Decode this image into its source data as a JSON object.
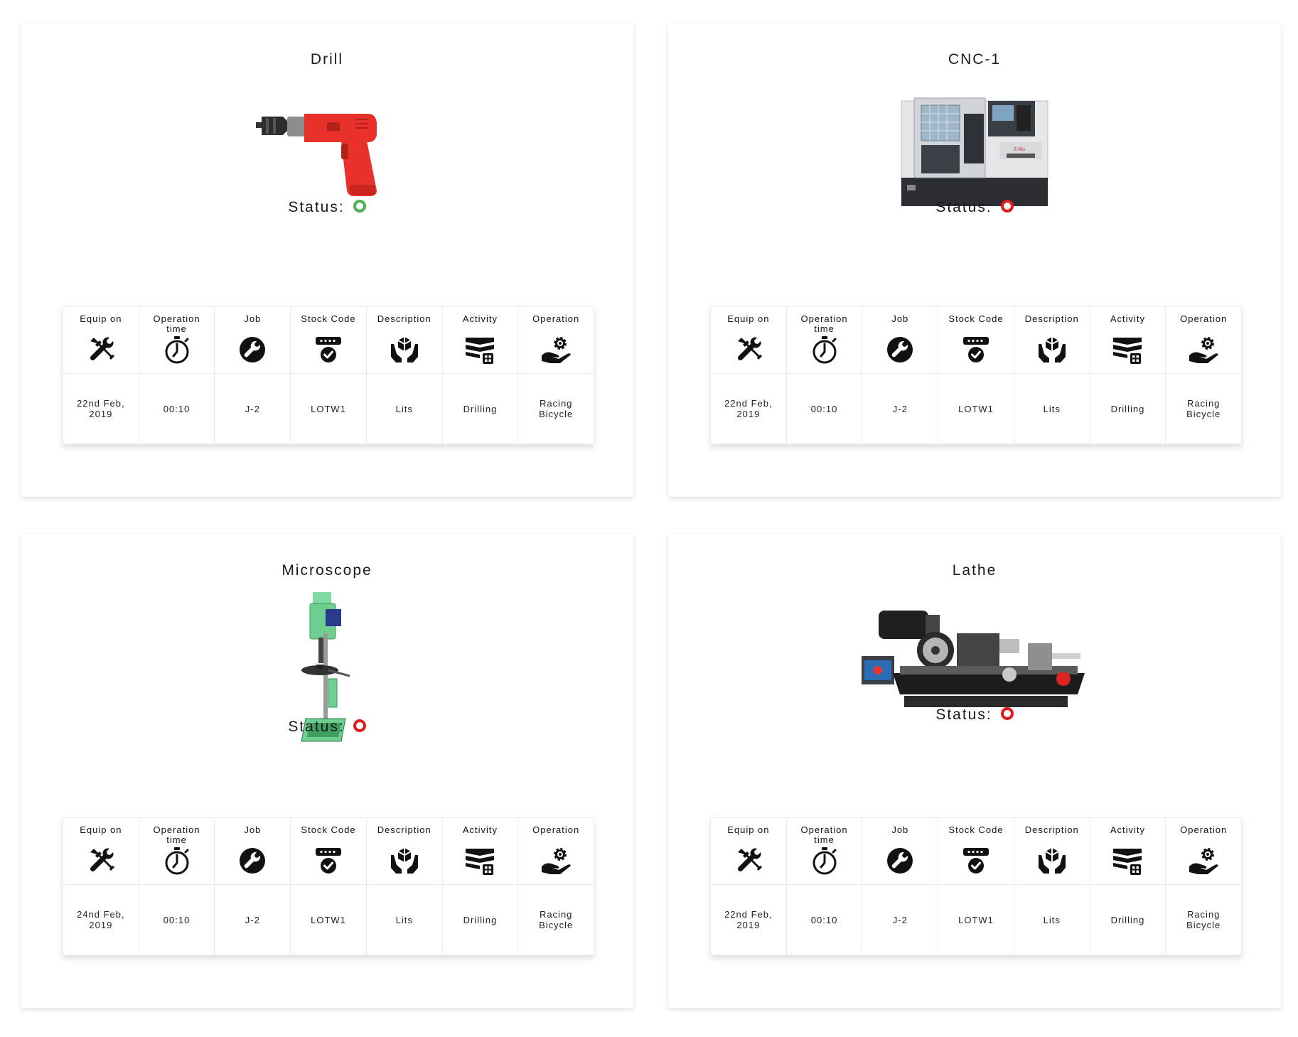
{
  "headers": {
    "equip_on": "Equip on",
    "operation_time": "Operation time",
    "job": "Job",
    "stock_code": "Stock Code",
    "description": "Description",
    "activity": "Activity",
    "operation": "Operation"
  },
  "icons": {
    "equip_on": "tools-icon",
    "operation_time": "stopwatch-icon",
    "job": "wrench-circle-icon",
    "stock_code": "stock-check-icon",
    "description": "hands-box-icon",
    "activity": "activity-board-icon",
    "operation": "hand-gear-icon"
  },
  "status_label": "Status:",
  "status_colors": {
    "online": "#4caf50",
    "offline": "#e41b1b"
  },
  "cards": [
    {
      "title": "Drill",
      "status": "online",
      "row": {
        "equip_on": "22nd Feb, 2019",
        "operation_time": "00:10",
        "job": "J-2",
        "stock_code": "LOTW1",
        "description": "Lits",
        "activity": "Drilling",
        "operation": "Racing Bicycle"
      }
    },
    {
      "title": "CNC-1",
      "status": "offline",
      "row": {
        "equip_on": "22nd Feb, 2019",
        "operation_time": "00:10",
        "job": "J-2",
        "stock_code": "LOTW1",
        "description": "Lits",
        "activity": "Drilling",
        "operation": "Racing Bicycle"
      }
    },
    {
      "title": "Microscope",
      "status": "offline",
      "row": {
        "equip_on": "24nd Feb, 2019",
        "operation_time": "00:10",
        "job": "J-2",
        "stock_code": "LOTW1",
        "description": "Lits",
        "activity": "Drilling",
        "operation": "Racing Bicycle"
      }
    },
    {
      "title": "Lathe",
      "status": "offline",
      "row": {
        "equip_on": "22nd Feb, 2019",
        "operation_time": "00:10",
        "job": "J-2",
        "stock_code": "LOTW1",
        "description": "Lits",
        "activity": "Drilling",
        "operation": "Racing Bicycle"
      }
    }
  ]
}
